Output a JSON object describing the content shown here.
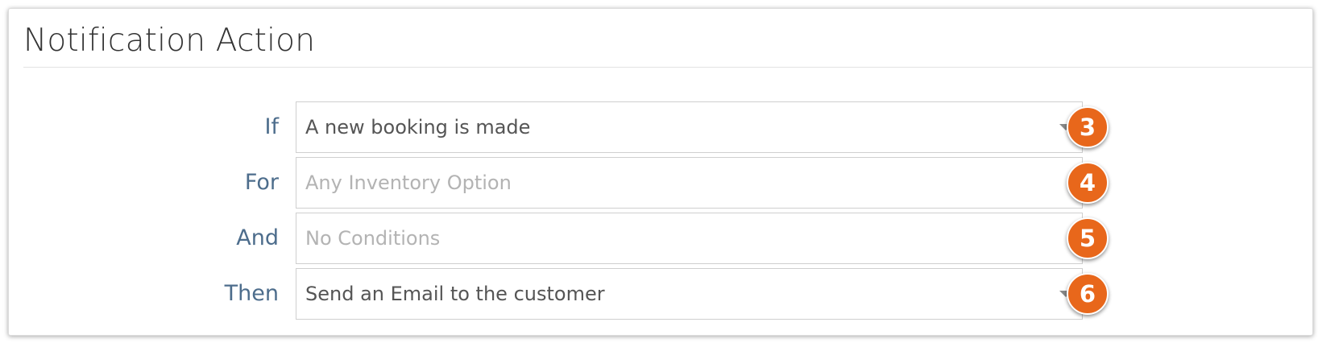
{
  "panel": {
    "title": "Notification Action"
  },
  "rows": [
    {
      "label": "If",
      "value": "A new booking is made",
      "placeholder": "",
      "has_dropdown": true,
      "step": "3"
    },
    {
      "label": "For",
      "value": "",
      "placeholder": "Any Inventory Option",
      "has_dropdown": false,
      "step": "4"
    },
    {
      "label": "And",
      "value": "",
      "placeholder": "No Conditions",
      "has_dropdown": false,
      "step": "5"
    },
    {
      "label": "Then",
      "value": "Send an Email to the customer",
      "placeholder": "",
      "has_dropdown": true,
      "step": "6"
    }
  ],
  "colors": {
    "label": "#4d6d8c",
    "badge": "#e8671b",
    "placeholder": "#b3b3b3",
    "value": "#555555"
  }
}
